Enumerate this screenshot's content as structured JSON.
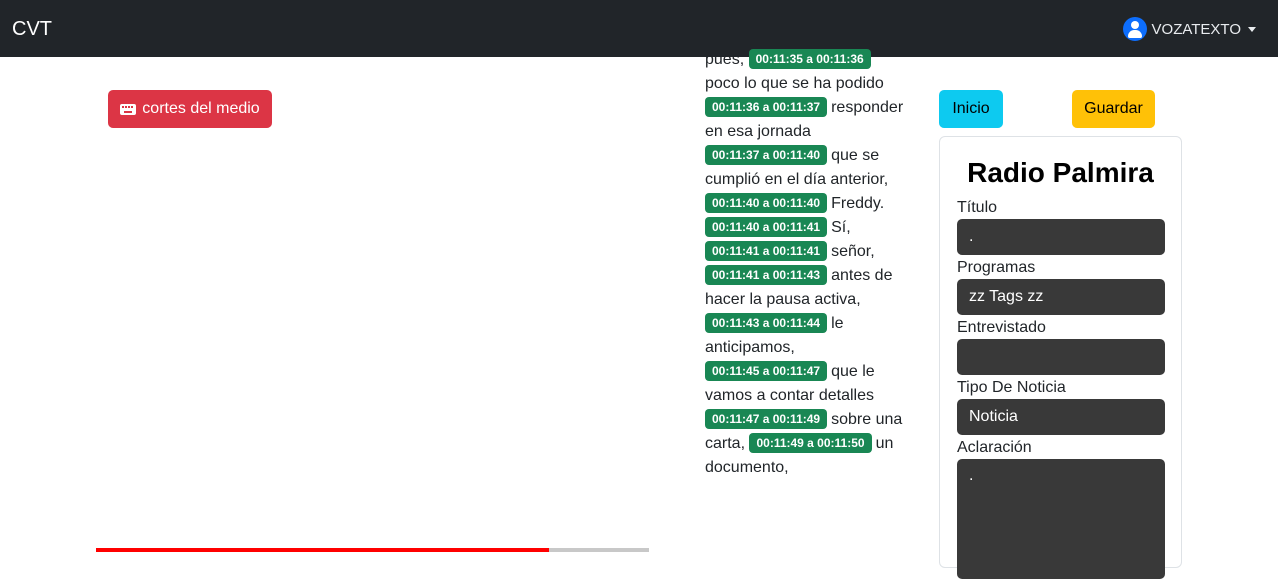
{
  "navbar": {
    "brand": "CVT",
    "user_name": "VOZATEXTO"
  },
  "left": {
    "cortes_button": "cortes del medio",
    "progress_fraction": 0.82
  },
  "transcript": [
    {
      "time": "",
      "text": "pues,"
    },
    {
      "time": "00:11:35 a 00:11:36",
      "text": "poco lo que se ha podido"
    },
    {
      "time": "00:11:36 a 00:11:37",
      "text": "responder en esa jornada"
    },
    {
      "time": "00:11:37 a 00:11:40",
      "text": "que se cumplió en el día anterior,"
    },
    {
      "time": "00:11:40 a 00:11:40",
      "text": "Freddy."
    },
    {
      "time": "00:11:40 a 00:11:41",
      "text": "Sí,"
    },
    {
      "time": "00:11:41 a 00:11:41",
      "text": "señor,"
    },
    {
      "time": "00:11:41 a 00:11:43",
      "text": "antes de hacer la pausa activa,"
    },
    {
      "time": "00:11:43 a 00:11:44",
      "text": "le anticipamos,"
    },
    {
      "time": "00:11:45 a 00:11:47",
      "text": "que le vamos a contar detalles"
    },
    {
      "time": "00:11:47 a 00:11:49",
      "text": "sobre una carta,"
    },
    {
      "time": "00:11:49 a 00:11:50",
      "text": "un documento,"
    }
  ],
  "actions": {
    "inicio": "Inicio",
    "guardar": "Guardar"
  },
  "form": {
    "title": "Radio Palmira",
    "titulo_label": "Título",
    "titulo_value": ".",
    "programas_label": "Programas",
    "programas_value": "zz Tags zz",
    "entrevistado_label": "Entrevistado",
    "entrevistado_value": "",
    "tipo_label": "Tipo De Noticia",
    "tipo_value": "Noticia",
    "aclaracion_label": "Aclaración",
    "aclaracion_value": "."
  }
}
